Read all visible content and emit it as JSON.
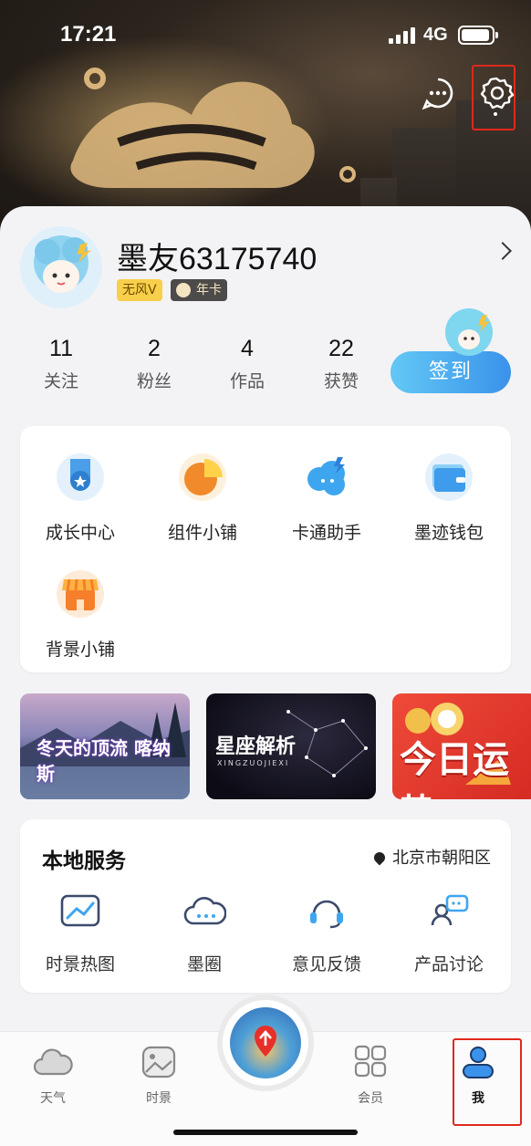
{
  "status_bar": {
    "time": "17:21",
    "network": "4G"
  },
  "profile": {
    "username": "墨友63175740",
    "badges": [
      "无风V",
      "年卡"
    ]
  },
  "stats": [
    {
      "value": "11",
      "label": "关注"
    },
    {
      "value": "2",
      "label": "粉丝"
    },
    {
      "value": "4",
      "label": "作品"
    },
    {
      "value": "22",
      "label": "获赞"
    }
  ],
  "checkin_label": "签到",
  "tools": [
    {
      "label": "成长中心",
      "icon": "medal-icon"
    },
    {
      "label": "组件小铺",
      "icon": "pie-widget-icon"
    },
    {
      "label": "卡通助手",
      "icon": "cartoon-cloud-icon"
    },
    {
      "label": "墨迹钱包",
      "icon": "wallet-icon"
    },
    {
      "label": "背景小铺",
      "icon": "shop-icon"
    }
  ],
  "banners": [
    {
      "text": "冬天的顶流 喀纳斯",
      "theme": "snow-lake"
    },
    {
      "text": "星座解析",
      "subtext": "XINGZUOJIEXI",
      "theme": "starry-night"
    },
    {
      "text": "今日运势",
      "theme": "red-fortune"
    }
  ],
  "local_services": {
    "title": "本地服务",
    "location": "北京市朝阳区",
    "items": [
      {
        "label": "时景热图",
        "icon": "heatmap-icon"
      },
      {
        "label": "墨圈",
        "icon": "cloud-chat-icon"
      },
      {
        "label": "意见反馈",
        "icon": "headset-icon"
      },
      {
        "label": "产品讨论",
        "icon": "discussion-icon"
      }
    ]
  },
  "tabbar": [
    {
      "label": "天气",
      "icon": "cloud-icon"
    },
    {
      "label": "时景",
      "icon": "image-icon"
    },
    {
      "label": "会员",
      "icon": "grid-icon"
    },
    {
      "label": "我",
      "icon": "person-icon"
    }
  ],
  "colors": {
    "accent": "#3a92ea",
    "highlight_outline": "#e0281c"
  }
}
